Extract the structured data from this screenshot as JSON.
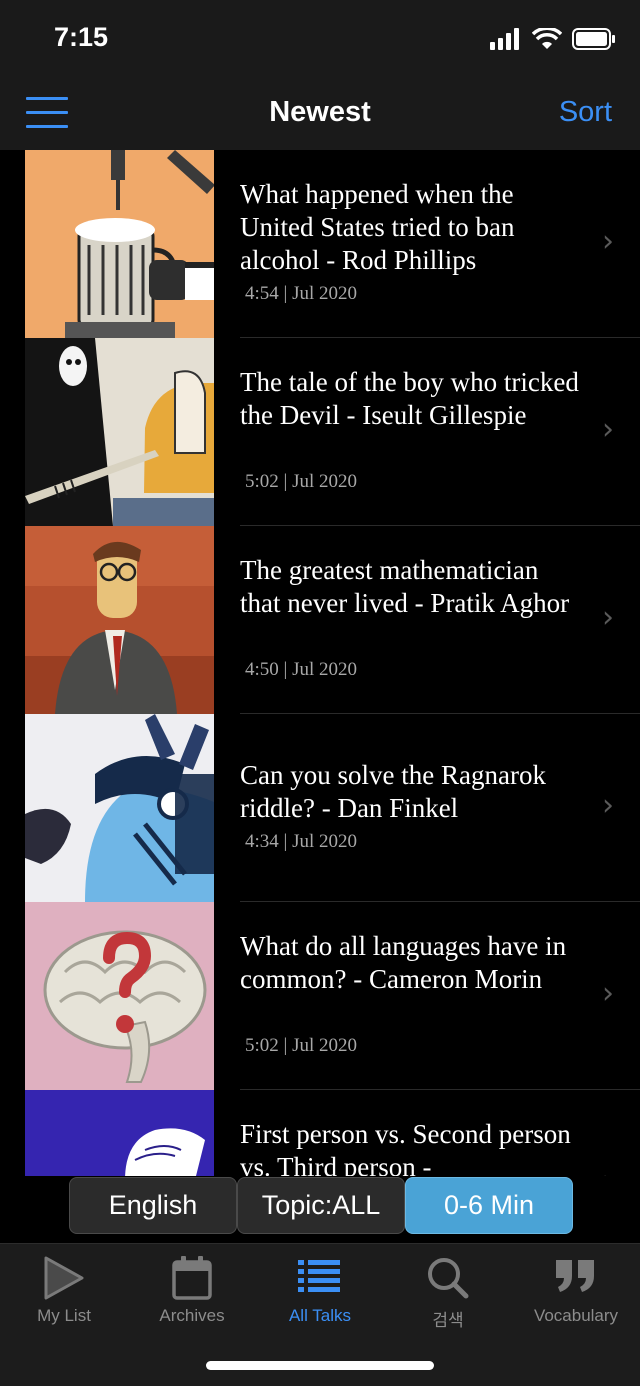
{
  "status_bar": {
    "time": "7:15"
  },
  "nav": {
    "title": "Newest",
    "sort_label": "Sort"
  },
  "talks": [
    {
      "title": "What happened when the United States tried to ban alcohol - Rod Phillips",
      "meta": "4:54 | Jul 2020"
    },
    {
      "title": "The tale of the boy who tricked the Devil - Iseult Gillespie",
      "meta": "5:02 | Jul 2020"
    },
    {
      "title": "The greatest mathematician that never lived - Pratik Aghor",
      "meta": "4:50 | Jul 2020"
    },
    {
      "title": "Can you solve the Ragnarok riddle? - Dan Finkel",
      "meta": "4:34 | Jul 2020"
    },
    {
      "title": "What do all languages have in common? - Cameron Morin",
      "meta": "5:02 | Jul 2020"
    },
    {
      "title": "First person vs. Second person vs. Third person -",
      "meta": ""
    }
  ],
  "filters": [
    {
      "label": "English",
      "active": false
    },
    {
      "label": "Topic:ALL",
      "active": false
    },
    {
      "label": "0-6 Min",
      "active": true
    }
  ],
  "tabs": [
    {
      "label": "My List",
      "icon": "play-icon",
      "active": false
    },
    {
      "label": "Archives",
      "icon": "calendar-icon",
      "active": false
    },
    {
      "label": "All Talks",
      "icon": "list-icon",
      "active": true
    },
    {
      "label": "검색",
      "icon": "search-icon",
      "active": false
    },
    {
      "label": "Vocabulary",
      "icon": "quote-icon",
      "active": false
    }
  ],
  "colors": {
    "accent": "#3b8ff5",
    "active_filter": "#4aa3d6",
    "background": "#000000",
    "bar": "#1a1a1a"
  }
}
